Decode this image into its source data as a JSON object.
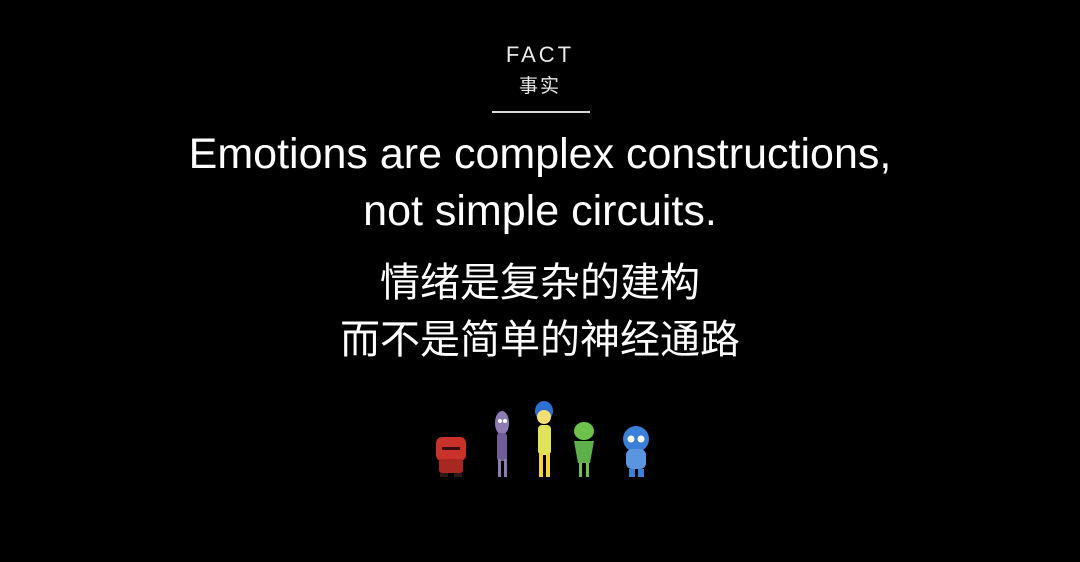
{
  "slide": {
    "label_en": "FACT",
    "label_zh": "事实",
    "headline_en_line1": "Emotions are complex constructions,",
    "headline_en_line2": "not simple circuits.",
    "headline_zh_line1": "情绪是复杂的建构",
    "headline_zh_line2": "而不是简单的神经通路"
  },
  "characters": {
    "icons": [
      "anger-figure-icon",
      "fear-figure-icon",
      "joy-figure-icon",
      "disgust-figure-icon",
      "sadness-figure-icon"
    ],
    "colors": {
      "anger": "#c8322b",
      "fear": "#8f7bb3",
      "joy": "#f2d43a",
      "joy_hair": "#2f6fd1",
      "disgust": "#6cc24a",
      "sadness": "#3a7fd8",
      "background": "#000000",
      "text": "#ffffff"
    }
  }
}
